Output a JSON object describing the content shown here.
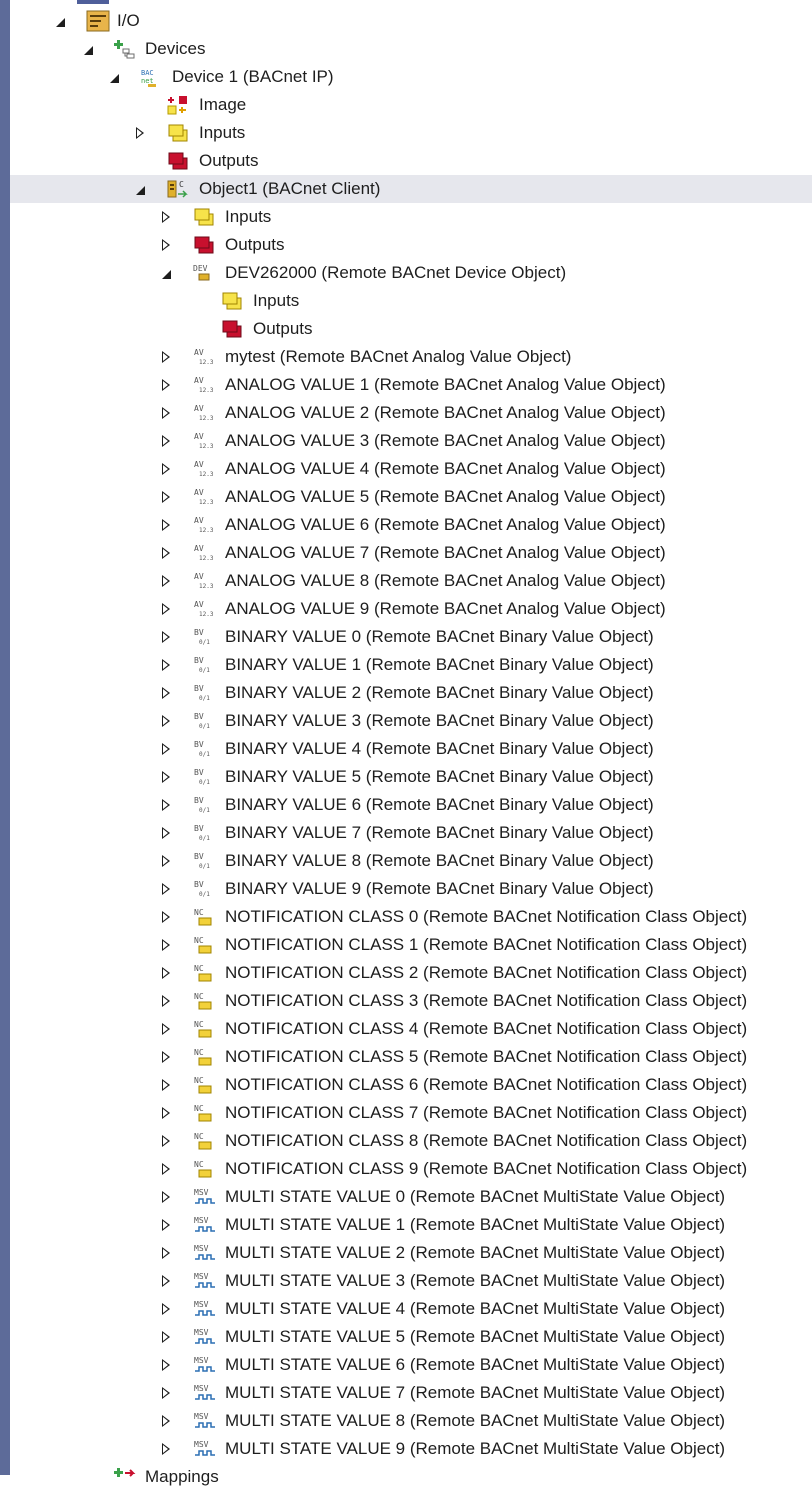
{
  "tree": {
    "io": {
      "label": "I/O"
    },
    "devices": {
      "label": "Devices"
    },
    "device1": {
      "label": "Device 1 (BACnet IP)"
    },
    "image": {
      "label": "Image"
    },
    "d_inputs": {
      "label": "Inputs"
    },
    "d_outputs": {
      "label": "Outputs"
    },
    "object1": {
      "label": "Object1 (BACnet Client)"
    },
    "o_inputs": {
      "label": "Inputs"
    },
    "o_outputs": {
      "label": "Outputs"
    },
    "dev": {
      "label": "DEV262000 (Remote BACnet Device Object)"
    },
    "dev_inputs": {
      "label": "Inputs"
    },
    "dev_outputs": {
      "label": "Outputs"
    },
    "objects": [
      {
        "label": "mytest (Remote BACnet Analog Value Object)",
        "kind": "av"
      },
      {
        "label": "ANALOG VALUE 1 (Remote BACnet Analog Value Object)",
        "kind": "av"
      },
      {
        "label": "ANALOG VALUE 2 (Remote BACnet Analog Value Object)",
        "kind": "av"
      },
      {
        "label": "ANALOG VALUE 3 (Remote BACnet Analog Value Object)",
        "kind": "av"
      },
      {
        "label": "ANALOG VALUE 4 (Remote BACnet Analog Value Object)",
        "kind": "av"
      },
      {
        "label": "ANALOG VALUE 5 (Remote BACnet Analog Value Object)",
        "kind": "av"
      },
      {
        "label": "ANALOG VALUE 6 (Remote BACnet Analog Value Object)",
        "kind": "av"
      },
      {
        "label": "ANALOG VALUE 7 (Remote BACnet Analog Value Object)",
        "kind": "av"
      },
      {
        "label": "ANALOG VALUE 8 (Remote BACnet Analog Value Object)",
        "kind": "av"
      },
      {
        "label": "ANALOG VALUE 9 (Remote BACnet Analog Value Object)",
        "kind": "av"
      },
      {
        "label": "BINARY VALUE 0 (Remote BACnet Binary Value Object)",
        "kind": "bv"
      },
      {
        "label": "BINARY VALUE 1 (Remote BACnet Binary Value Object)",
        "kind": "bv"
      },
      {
        "label": "BINARY VALUE 2 (Remote BACnet Binary Value Object)",
        "kind": "bv"
      },
      {
        "label": "BINARY VALUE 3 (Remote BACnet Binary Value Object)",
        "kind": "bv"
      },
      {
        "label": "BINARY VALUE 4 (Remote BACnet Binary Value Object)",
        "kind": "bv"
      },
      {
        "label": "BINARY VALUE 5 (Remote BACnet Binary Value Object)",
        "kind": "bv"
      },
      {
        "label": "BINARY VALUE 6 (Remote BACnet Binary Value Object)",
        "kind": "bv"
      },
      {
        "label": "BINARY VALUE 7 (Remote BACnet Binary Value Object)",
        "kind": "bv"
      },
      {
        "label": "BINARY VALUE 8 (Remote BACnet Binary Value Object)",
        "kind": "bv"
      },
      {
        "label": "BINARY VALUE 9 (Remote BACnet Binary Value Object)",
        "kind": "bv"
      },
      {
        "label": "NOTIFICATION CLASS 0 (Remote BACnet Notification Class Object)",
        "kind": "nc"
      },
      {
        "label": "NOTIFICATION CLASS 1 (Remote BACnet Notification Class Object)",
        "kind": "nc"
      },
      {
        "label": "NOTIFICATION CLASS 2 (Remote BACnet Notification Class Object)",
        "kind": "nc"
      },
      {
        "label": "NOTIFICATION CLASS 3 (Remote BACnet Notification Class Object)",
        "kind": "nc"
      },
      {
        "label": "NOTIFICATION CLASS 4 (Remote BACnet Notification Class Object)",
        "kind": "nc"
      },
      {
        "label": "NOTIFICATION CLASS 5 (Remote BACnet Notification Class Object)",
        "kind": "nc"
      },
      {
        "label": "NOTIFICATION CLASS 6 (Remote BACnet Notification Class Object)",
        "kind": "nc"
      },
      {
        "label": "NOTIFICATION CLASS 7 (Remote BACnet Notification Class Object)",
        "kind": "nc"
      },
      {
        "label": "NOTIFICATION CLASS 8 (Remote BACnet Notification Class Object)",
        "kind": "nc"
      },
      {
        "label": "NOTIFICATION CLASS 9 (Remote BACnet Notification Class Object)",
        "kind": "nc"
      },
      {
        "label": "MULTI STATE VALUE 0 (Remote BACnet MultiState Value Object)",
        "kind": "msv"
      },
      {
        "label": "MULTI STATE VALUE 1 (Remote BACnet MultiState Value Object)",
        "kind": "msv"
      },
      {
        "label": "MULTI STATE VALUE 2 (Remote BACnet MultiState Value Object)",
        "kind": "msv"
      },
      {
        "label": "MULTI STATE VALUE 3 (Remote BACnet MultiState Value Object)",
        "kind": "msv"
      },
      {
        "label": "MULTI STATE VALUE 4 (Remote BACnet MultiState Value Object)",
        "kind": "msv"
      },
      {
        "label": "MULTI STATE VALUE 5 (Remote BACnet MultiState Value Object)",
        "kind": "msv"
      },
      {
        "label": "MULTI STATE VALUE 6 (Remote BACnet MultiState Value Object)",
        "kind": "msv"
      },
      {
        "label": "MULTI STATE VALUE 7 (Remote BACnet MultiState Value Object)",
        "kind": "msv"
      },
      {
        "label": "MULTI STATE VALUE 8 (Remote BACnet MultiState Value Object)",
        "kind": "msv"
      },
      {
        "label": "MULTI STATE VALUE 9 (Remote BACnet MultiState Value Object)",
        "kind": "msv"
      }
    ],
    "mappings": {
      "label": "Mappings"
    }
  },
  "icons": {
    "io": "io-folder-icon",
    "devices": "devices-tree-icon",
    "device": "bacnet-device-icon",
    "image": "process-image-icon",
    "inputs": "inputs-icon",
    "outputs": "outputs-icon",
    "client": "bacnet-client-icon",
    "dev": "remote-device-object-icon",
    "av": "analog-value-icon",
    "bv": "binary-value-icon",
    "nc": "notification-class-icon",
    "msv": "multistate-value-icon",
    "mappings": "mappings-icon"
  },
  "colors": {
    "left_strip": "#5d6b99",
    "selection": "#e6e7ed",
    "input_yellow": "#f7e34a",
    "output_red": "#c8102e",
    "text": "#1e1e1e"
  }
}
